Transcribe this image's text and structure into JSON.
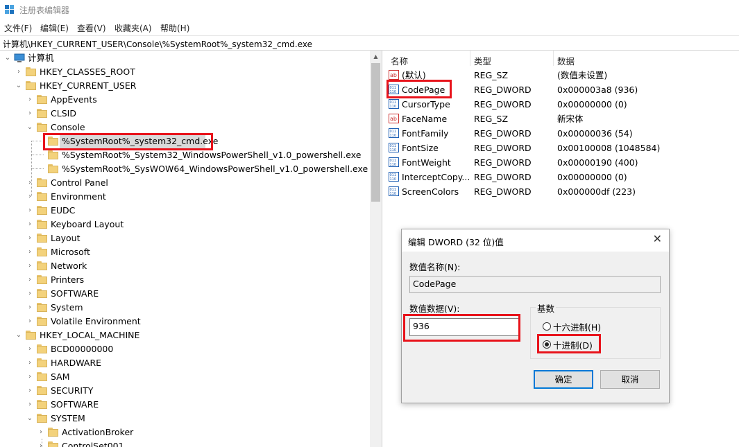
{
  "window": {
    "title": "注册表编辑器"
  },
  "menu": [
    "文件(F)",
    "编辑(E)",
    "查看(V)",
    "收藏夹(A)",
    "帮助(H)"
  ],
  "address": "计算机\\HKEY_CURRENT_USER\\Console\\%SystemRoot%_system32_cmd.exe",
  "tree": {
    "root": "计算机",
    "hkcr": "HKEY_CLASSES_ROOT",
    "hkcu": "HKEY_CURRENT_USER",
    "hkcu_children": [
      "AppEvents",
      "CLSID",
      "Console"
    ],
    "console_children": [
      "%SystemRoot%_system32_cmd.exe",
      "%SystemRoot%_System32_WindowsPowerShell_v1.0_powershell.exe",
      "%SystemRoot%_SysWOW64_WindowsPowerShell_v1.0_powershell.exe"
    ],
    "hkcu_children_after": [
      "Control Panel",
      "Environment",
      "EUDC",
      "Keyboard Layout",
      "Layout",
      "Microsoft",
      "Network",
      "Printers",
      "SOFTWARE",
      "System",
      "Volatile Environment"
    ],
    "hklm": "HKEY_LOCAL_MACHINE",
    "hklm_children": [
      "BCD00000000",
      "HARDWARE",
      "SAM",
      "SECURITY",
      "SOFTWARE",
      "SYSTEM"
    ],
    "system_children": [
      "ActivationBroker",
      "ControlSet001"
    ]
  },
  "columns": {
    "name": "名称",
    "type": "类型",
    "data": "数据"
  },
  "values": [
    {
      "icon": "string-value-icon",
      "name": "(默认)",
      "type": "REG_SZ",
      "data": "(数值未设置)"
    },
    {
      "icon": "binary-value-icon",
      "name": "CodePage",
      "type": "REG_DWORD",
      "data": "0x000003a8 (936)"
    },
    {
      "icon": "binary-value-icon",
      "name": "CursorType",
      "type": "REG_DWORD",
      "data": "0x00000000 (0)"
    },
    {
      "icon": "string-value-icon",
      "name": "FaceName",
      "type": "REG_SZ",
      "data": "新宋体"
    },
    {
      "icon": "binary-value-icon",
      "name": "FontFamily",
      "type": "REG_DWORD",
      "data": "0x00000036 (54)"
    },
    {
      "icon": "binary-value-icon",
      "name": "FontSize",
      "type": "REG_DWORD",
      "data": "0x00100008 (1048584)"
    },
    {
      "icon": "binary-value-icon",
      "name": "FontWeight",
      "type": "REG_DWORD",
      "data": "0x00000190 (400)"
    },
    {
      "icon": "binary-value-icon",
      "name": "InterceptCopy...",
      "type": "REG_DWORD",
      "data": "0x00000000 (0)"
    },
    {
      "icon": "binary-value-icon",
      "name": "ScreenColors",
      "type": "REG_DWORD",
      "data": "0x000000df (223)"
    }
  ],
  "dialog": {
    "title": "编辑 DWORD (32 位)值",
    "name_label": "数值名称(N):",
    "name_value": "CodePage",
    "data_label": "数值数据(V):",
    "data_value": "936",
    "base_label": "基数",
    "hex_label": "十六进制(H)",
    "dec_label": "十进制(D)",
    "selected_base": "十进制(D)",
    "ok": "确定",
    "cancel": "取消"
  },
  "colors": {
    "highlight": "#e8131b",
    "accent": "#0078d7"
  }
}
